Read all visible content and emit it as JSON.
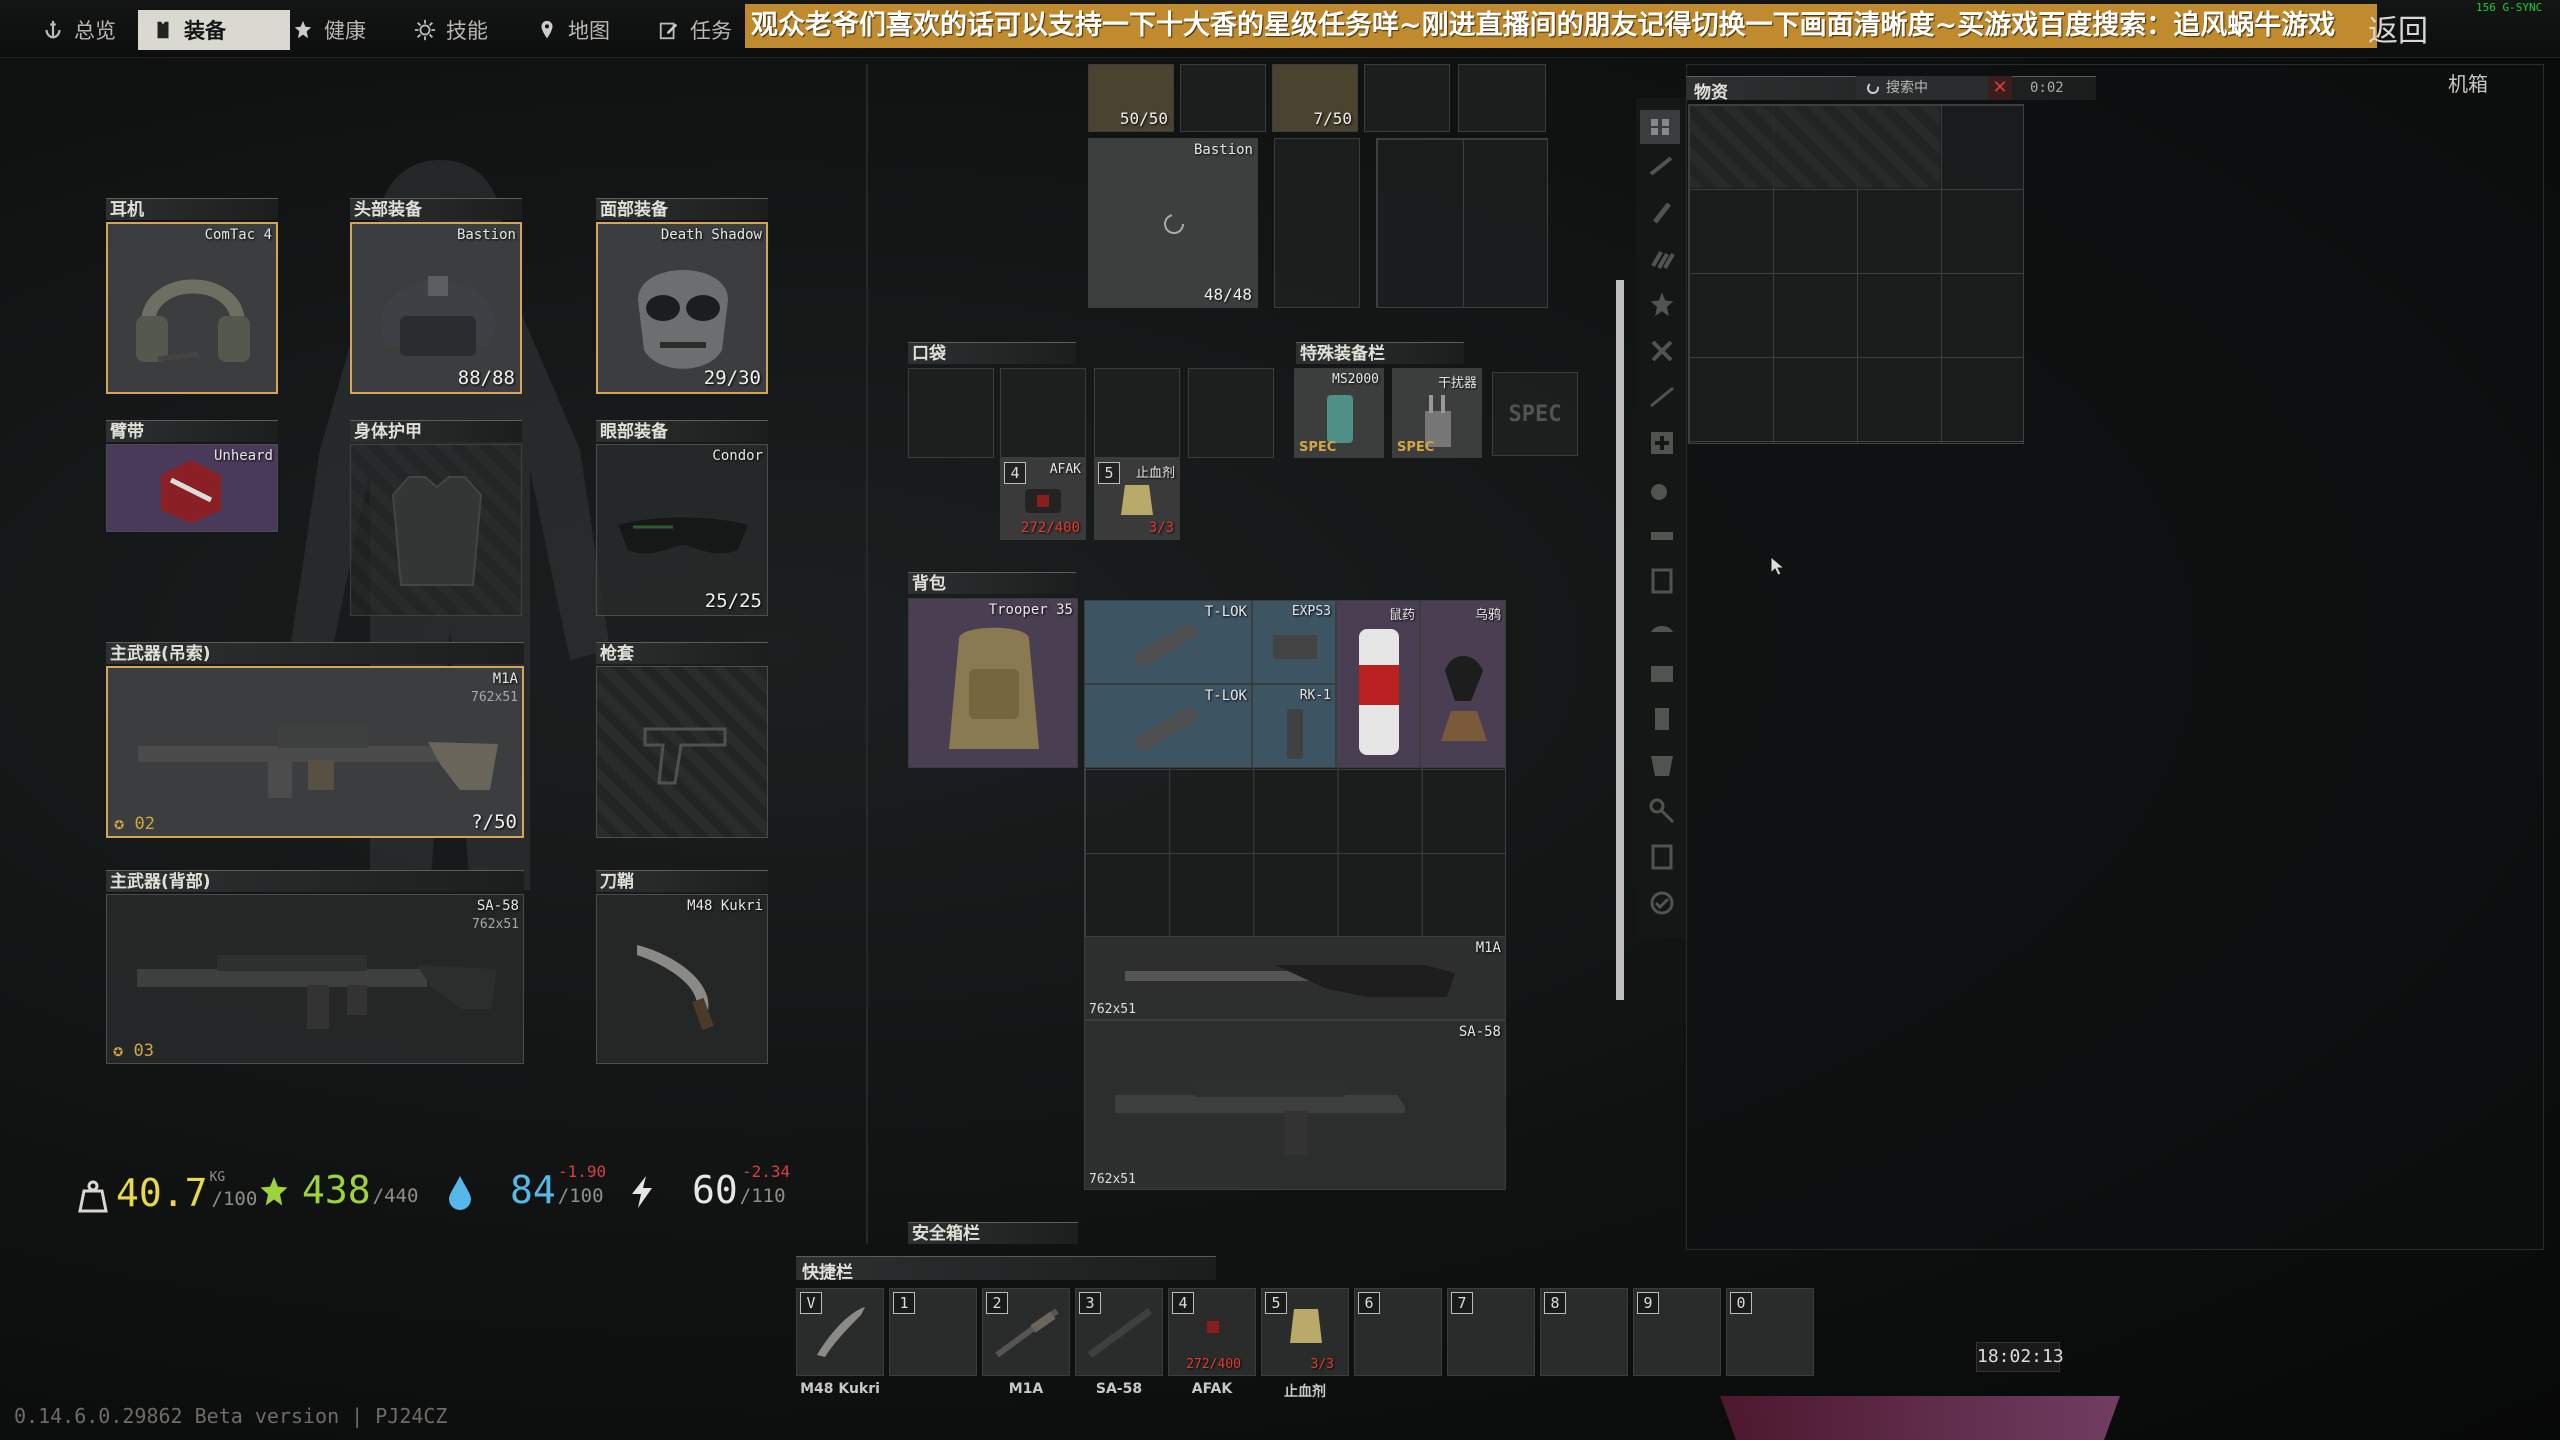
{
  "nav": {
    "tabs": [
      {
        "label": "总览",
        "icon": "anchor-icon"
      },
      {
        "label": "装备",
        "icon": "gear-vest-icon"
      },
      {
        "label": "健康",
        "icon": "health-star-icon"
      },
      {
        "label": "技能",
        "icon": "skill-sun-icon"
      },
      {
        "label": "地图",
        "icon": "map-pin-icon"
      },
      {
        "label": "任务",
        "icon": "task-edit-icon"
      }
    ],
    "banner": "观众老爷们喜欢的话可以支持一下十大香的星级任务咩~刚进直播间的朋友记得切换一下画面清晰度~买游戏百度搜索：追风蜗牛游戏",
    "back_label": "返回",
    "fps_overlay": "156 G-SYNC"
  },
  "gear": {
    "earpiece": {
      "title": "耳机",
      "item": "ComTac 4"
    },
    "headwear": {
      "title": "头部装备",
      "item": "Bastion",
      "durability": "88/88"
    },
    "face": {
      "title": "面部装备",
      "item": "Death Shadow",
      "durability": "29/30"
    },
    "armband": {
      "title": "臂带",
      "item": "Unheard"
    },
    "body_armor": {
      "title": "身体护甲"
    },
    "eyewear": {
      "title": "眼部装备",
      "item": "Condor",
      "durability": "25/25"
    },
    "primary_sling": {
      "title": "主武器(吊索)",
      "item": "M1A",
      "ammo": "762x51",
      "rank": "02",
      "count": "?/50"
    },
    "holster": {
      "title": "枪套"
    },
    "primary_back": {
      "title": "主武器(背部)",
      "item": "SA-58",
      "ammo": "762x51",
      "rank": "03"
    },
    "scabbard": {
      "title": "刀鞘",
      "item": "M48 Kukri"
    }
  },
  "stats": {
    "weight": {
      "value": "40.7",
      "unit": "KG",
      "max": "/100"
    },
    "health": {
      "value": "438",
      "max": "/440"
    },
    "hydration": {
      "value": "84",
      "max": "/100",
      "delta": "-1.90"
    },
    "energy": {
      "value": "60",
      "max": "/110",
      "delta": "-2.34"
    }
  },
  "rig": {
    "top_items": [
      {
        "count": "50/50"
      },
      {
        "count": "7/50"
      }
    ],
    "plate_label": "Bastion",
    "plate_count": "48/48"
  },
  "pockets": {
    "title": "口袋",
    "items": [
      {
        "slot": "4",
        "name": "AFAK",
        "count": "272/400"
      },
      {
        "slot": "5",
        "name": "止血剂",
        "count": "3/3"
      }
    ]
  },
  "special": {
    "title": "特殊装备栏",
    "items": [
      {
        "name": "MS2000",
        "tag": "SPEC"
      },
      {
        "name": "干扰器",
        "tag": "SPEC"
      }
    ],
    "empty_label": "SPEC"
  },
  "backpack": {
    "title": "背包",
    "item": "Trooper 35",
    "contents": [
      {
        "name": "T-LOK"
      },
      {
        "name": "EXPS3"
      },
      {
        "name": "鼠药"
      },
      {
        "name": "乌鸦"
      },
      {
        "name": "T-LOK"
      },
      {
        "name": "RK-1"
      }
    ],
    "weapons": [
      {
        "name": "M1A",
        "ammo": "762x51"
      },
      {
        "name": "SA-58",
        "ammo": "762x51"
      }
    ]
  },
  "secure": {
    "title": "安全箱栏"
  },
  "stash": {
    "title": "物资",
    "search_label": "搜索中",
    "timer": "0:02",
    "container_label": "机箱"
  },
  "quickbar": {
    "title": "快捷栏",
    "slots": [
      {
        "key": "V",
        "label": "M48 Kukri"
      },
      {
        "key": "1",
        "label": ""
      },
      {
        "key": "2",
        "label": "M1A"
      },
      {
        "key": "3",
        "label": "SA-58"
      },
      {
        "key": "4",
        "label": "AFAK",
        "count": "272/400"
      },
      {
        "key": "5",
        "label": "止血剂",
        "count": "3/3"
      },
      {
        "key": "6",
        "label": ""
      },
      {
        "key": "7",
        "label": ""
      },
      {
        "key": "8",
        "label": ""
      },
      {
        "key": "9",
        "label": ""
      },
      {
        "key": "0",
        "label": ""
      }
    ]
  },
  "footer": {
    "version": "0.14.6.0.29862 Beta version | PJ24CZ",
    "clock": "18:02:13"
  },
  "colors": {
    "accent_gold": "#d6a35a",
    "banner": "#c08a2e",
    "weight_yellow": "#e8d84a",
    "health_green": "#9ed33c",
    "hydration_blue": "#57b7e8",
    "energy_white": "#e6e6e6",
    "warn_red": "#e53a2e"
  }
}
